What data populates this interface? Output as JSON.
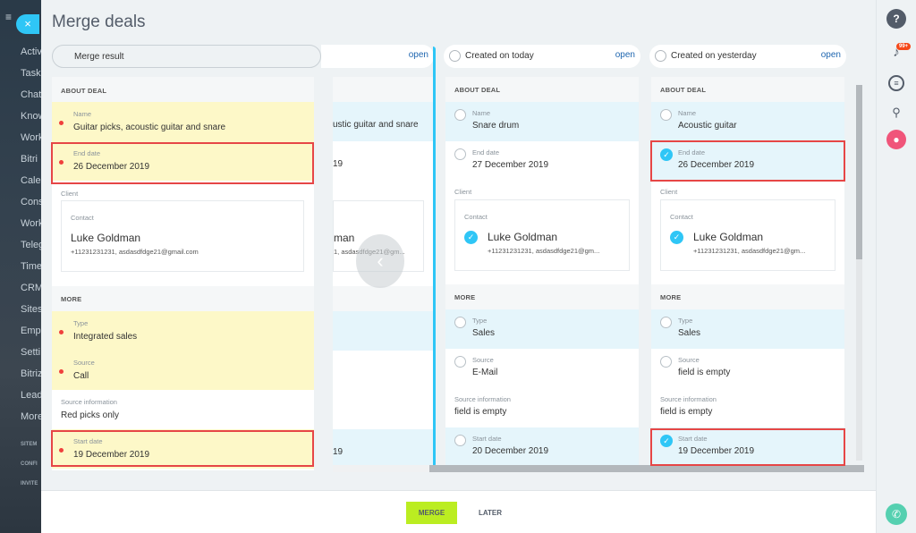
{
  "slider": {
    "title": "Merge deals",
    "close_glyph": "×"
  },
  "bg_menu": {
    "items": [
      "Activ",
      "Task",
      "Chat",
      "Know",
      "Work",
      "Bitri",
      "Cale",
      "Cons",
      "Work",
      "Teleg",
      "Time",
      "CRM",
      "Sites",
      "Emp",
      "Setti",
      "Bitriz",
      "Lead",
      "More"
    ],
    "sections": [
      "SITEM",
      "CONFI",
      "INVITE"
    ]
  },
  "merge_result": {
    "header": "Merge result",
    "about_title": "ABOUT DEAL",
    "name_label": "Name",
    "name_value": "Guitar picks, acoustic guitar and snare",
    "end_label": "End date",
    "end_value": "26 December 2019",
    "client_label": "Client",
    "contact_label": "Contact",
    "contact_name": "Luke Goldman",
    "contact_info": "+11231231231, asdasdfdge21@gmail.com",
    "more_title": "MORE",
    "type_label": "Type",
    "type_value": "Integrated sales",
    "source_label": "Source",
    "source_value": "Call",
    "srcinfo_label": "Source information",
    "srcinfo_value": "Red picks only",
    "start_label": "Start date",
    "start_value": "19 December 2019"
  },
  "partial": {
    "open": "open",
    "name_value": "ustic guitar and snare",
    "end_value": "19",
    "contact_name": "man",
    "contact_info": "1, asdasdfdge21@gm...",
    "start_value": "19"
  },
  "today": {
    "header": "Created on today",
    "open": "open",
    "about_title": "ABOUT DEAL",
    "name_label": "Name",
    "name_value": "Snare drum",
    "end_label": "End date",
    "end_value": "27 December 2019",
    "client_label": "Client",
    "contact_label": "Contact",
    "contact_name": "Luke Goldman",
    "contact_info": "+11231231231, asdasdfdge21@gm...",
    "more_title": "MORE",
    "type_label": "Type",
    "type_value": "Sales",
    "source_label": "Source",
    "source_value": "E-Mail",
    "srcinfo_label": "Source information",
    "srcinfo_value": "field is empty",
    "start_label": "Start date",
    "start_value": "20 December 2019"
  },
  "yesterday": {
    "header": "Created on yesterday",
    "open": "open",
    "about_title": "ABOUT DEAL",
    "name_label": "Name",
    "name_value": "Acoustic guitar",
    "end_label": "End date",
    "end_value": "26 December 2019",
    "client_label": "Client",
    "contact_label": "Contact",
    "contact_name": "Luke Goldman",
    "contact_info": "+11231231231, asdasdfdge21@gm...",
    "more_title": "MORE",
    "type_label": "Type",
    "type_value": "Sales",
    "source_label": "Source",
    "source_value": "field is empty",
    "srcinfo_label": "Source information",
    "srcinfo_value": "field is empty",
    "start_label": "Start date",
    "start_value": "19 December 2019"
  },
  "right_bar": {
    "help": "?",
    "badge": "99+"
  },
  "footer": {
    "merge": "MERGE",
    "later": "LATER"
  },
  "colors": {
    "accent": "#2fc6f6",
    "merge_button": "#bbed21",
    "highlight": "#e64646"
  }
}
